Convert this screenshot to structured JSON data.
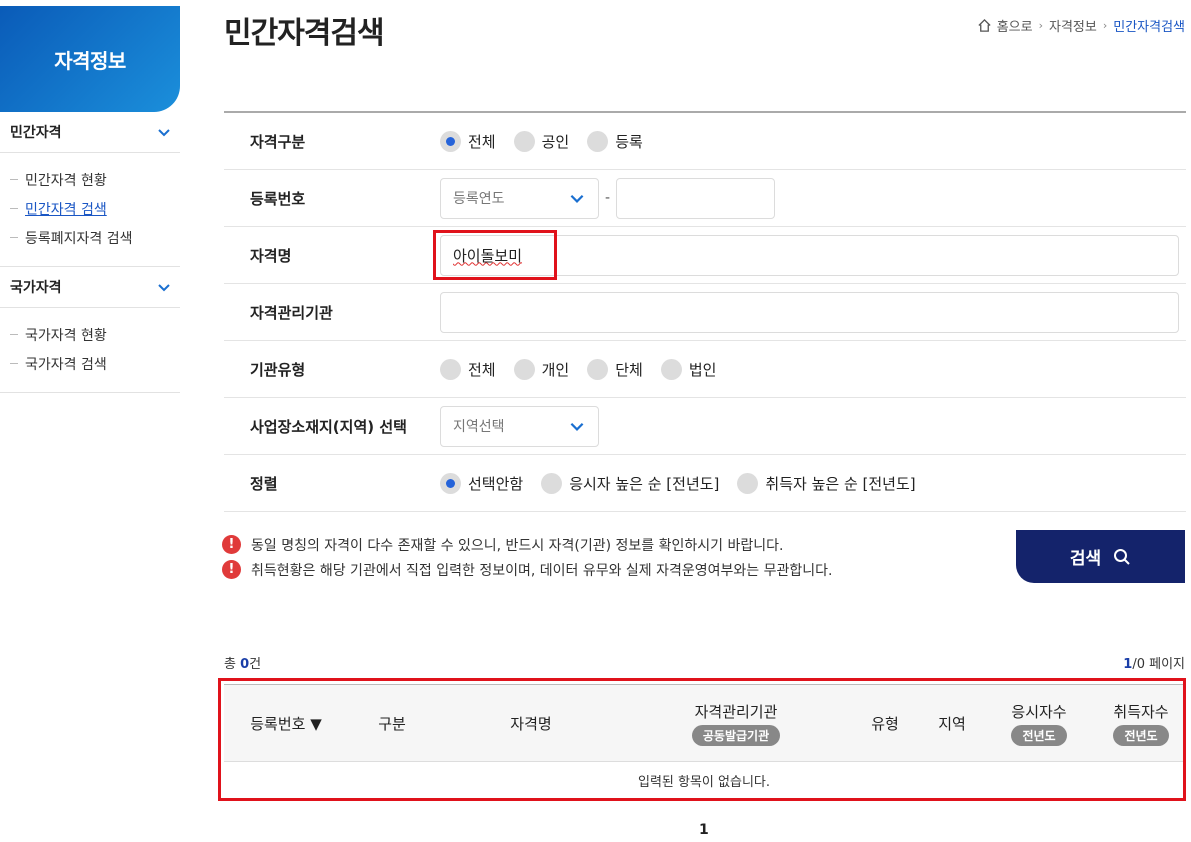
{
  "sidebar": {
    "title": "자격정보",
    "groups": [
      {
        "label": "민간자격",
        "items": [
          "민간자격 현황",
          "민간자격 검색",
          "등록폐지자격 검색"
        ]
      },
      {
        "label": "국가자격",
        "items": [
          "국가자격 현황",
          "국가자격 검색"
        ]
      }
    ]
  },
  "page": {
    "title": "민간자격검색"
  },
  "breadcrumb": {
    "home": "홈으로",
    "section": "자격정보",
    "current": "민간자격검색"
  },
  "form": {
    "category": {
      "label": "자격구분",
      "options": [
        "전체",
        "공인",
        "등록"
      ],
      "selected": "전체"
    },
    "reg_number": {
      "label": "등록번호",
      "year_placeholder": "등록연도",
      "separator": "-"
    },
    "name": {
      "label": "자격명",
      "value": "아이돌보미"
    },
    "agency": {
      "label": "자격관리기관",
      "value": ""
    },
    "agency_type": {
      "label": "기관유형",
      "options": [
        "전체",
        "개인",
        "단체",
        "법인"
      ]
    },
    "region": {
      "label": "사업장소재지(지역) 선택",
      "placeholder": "지역선택"
    },
    "sort": {
      "label": "정렬",
      "options": [
        "선택안함",
        "응시자 높은 순 [전년도]",
        "취득자 높은 순 [전년도]"
      ],
      "selected": "선택안함"
    }
  },
  "notes": [
    "동일 명칭의 자격이 다수 존재할 수 있으니, 반드시 자격(기관) 정보를 확인하시기 바랍니다.",
    "취득현황은 해당 기관에서 직접 입력한 정보이며, 데이터 유무와 실제 자격운영여부와는 무관합니다."
  ],
  "search_button": "검색",
  "results": {
    "total_prefix": "총 ",
    "total_count": "0",
    "total_suffix": "건",
    "page_current": "1",
    "page_rest": "/0 페이지",
    "columns": {
      "reg_number": "등록번호 ▼",
      "category": "구분",
      "name": "자격명",
      "agency": "자격관리기관",
      "agency_pill": "공동발급기관",
      "type": "유형",
      "region": "지역",
      "applicants": "응시자수",
      "applicants_pill": "전년도",
      "acquirers": "취득자수",
      "acquirers_pill": "전년도"
    },
    "empty_message": "입력된 항목이 없습니다."
  },
  "pagination": {
    "current": "1"
  },
  "colors": {
    "accent": "#2563d9",
    "button": "#14236b",
    "highlight": "#e0121b",
    "warning": "#e03a3a"
  }
}
